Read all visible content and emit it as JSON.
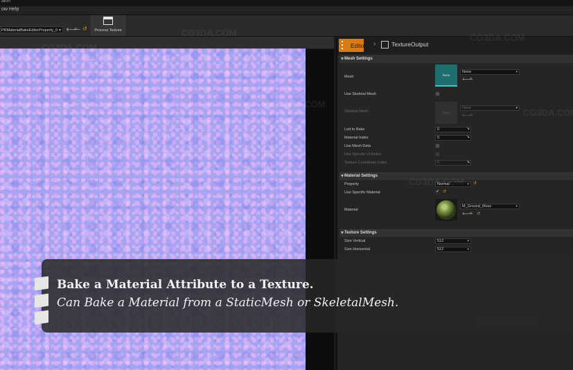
{
  "window": {
    "title": "aker"
  },
  "menu": {
    "items": [
      "ow",
      "Help"
    ]
  },
  "toolbar": {
    "property_dropdown": "PRMaterialBakeEditorProperty_0",
    "process_label": "Process Texture"
  },
  "panel": {
    "breadcrumb": {
      "editor": "Editor",
      "current": "TextureOutput"
    },
    "sections": {
      "mesh": "Mesh Settings",
      "material": "Material Settings",
      "texture": "Texture Settings"
    },
    "mesh_settings": {
      "mesh_label": "Mesh",
      "mesh_thumb": "None",
      "mesh_value": "None",
      "use_skeletal_label": "Use Skeletal Mesh",
      "skeletal_label": "Skeletal Mesh",
      "skeletal_thumb": "None",
      "skeletal_value": "None",
      "lod_label": "Lod to Bake",
      "lod_value": "0",
      "material_index_label": "Material Index",
      "material_index_value": "0",
      "use_mesh_data_label": "Use Mesh Data",
      "use_specific_uv_label": "Use Specific UVIndex",
      "tex_coord_label": "Texture Coordinate Index",
      "tex_coord_value": "0"
    },
    "material_settings": {
      "property_label": "Property",
      "property_value": "Normal",
      "use_specific_label": "Use Specific Material",
      "material_label": "Material",
      "material_value": "M_Ground_Moss"
    },
    "texture_settings": {
      "size_v_label": "Size Vertical",
      "size_v_value": "512",
      "size_h_label": "Size Horizontal",
      "size_h_value": "512"
    }
  },
  "caption": {
    "line1": "Bake a Material Attribute to a Texture.",
    "line2": "Can Bake a Material from a StaticMesh or SkeletalMesh."
  },
  "watermark": "CG3DA.COM",
  "colors": {
    "accent": "#d87b15",
    "texture": "#a9a4ef",
    "mesh_thumb": "#1f6e6e"
  }
}
